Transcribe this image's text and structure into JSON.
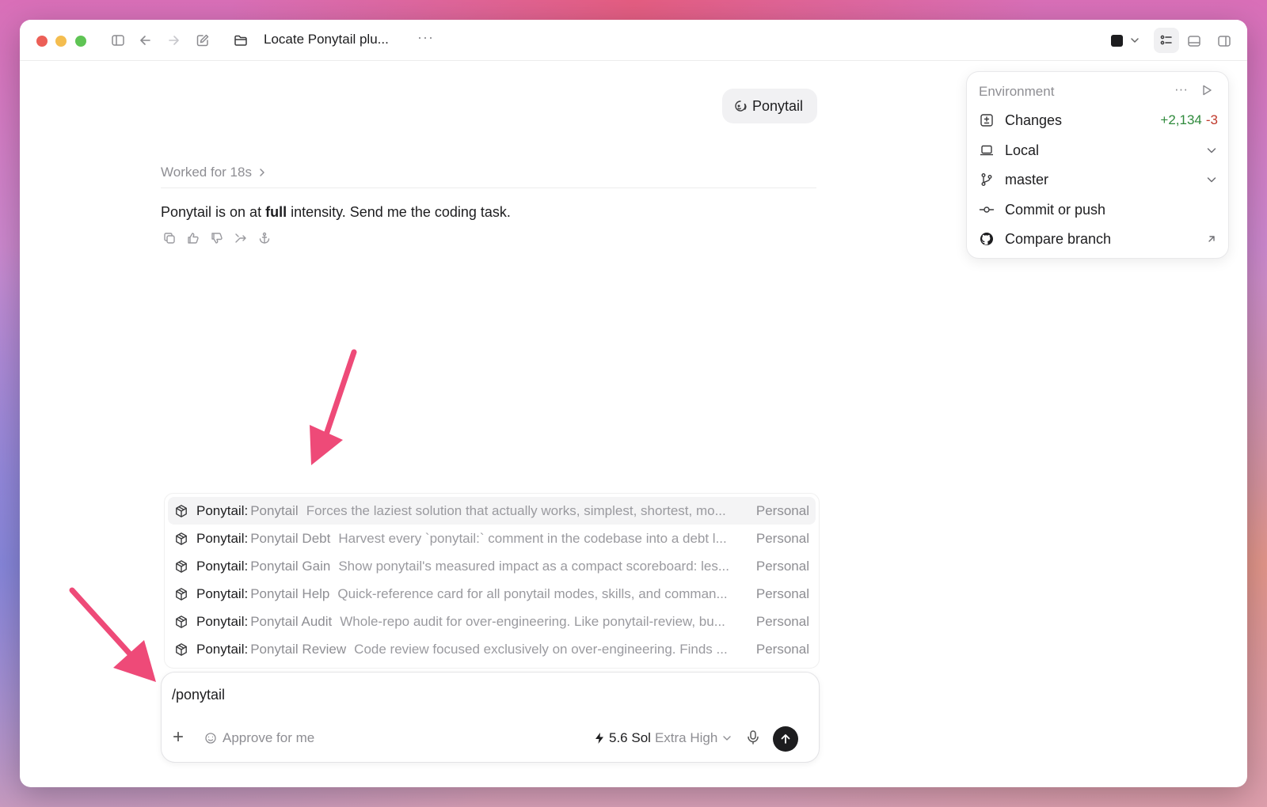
{
  "window": {
    "title": "Locate Ponytail plu...",
    "more_label": "···"
  },
  "chat": {
    "user_message": "Ponytail",
    "worked_label": "Worked for 18s",
    "assistant_message": {
      "before": "Ponytail is on at ",
      "bold": "full",
      "after": " intensity. Send me the coding task."
    }
  },
  "environment": {
    "title": "Environment",
    "more_label": "···",
    "changes": {
      "label": "Changes",
      "added": "+2,134",
      "removed": "-3"
    },
    "location": {
      "label": "Local"
    },
    "branch": {
      "label": "master"
    },
    "commit": {
      "label": "Commit or push"
    },
    "compare": {
      "label": "Compare branch"
    }
  },
  "suggestions": [
    {
      "plugin": "Ponytail",
      "skill": "Ponytail",
      "description": "Forces the laziest solution that actually works, simplest, shortest, mo...",
      "scope": "Personal",
      "selected": true
    },
    {
      "plugin": "Ponytail",
      "skill": "Ponytail Debt",
      "description": "Harvest every `ponytail:` comment in the codebase into a debt l...",
      "scope": "Personal",
      "selected": false
    },
    {
      "plugin": "Ponytail",
      "skill": "Ponytail Gain",
      "description": "Show ponytail's measured impact as a compact scoreboard: les...",
      "scope": "Personal",
      "selected": false
    },
    {
      "plugin": "Ponytail",
      "skill": "Ponytail Help",
      "description": "Quick-reference card for all ponytail modes, skills, and comman...",
      "scope": "Personal",
      "selected": false
    },
    {
      "plugin": "Ponytail",
      "skill": "Ponytail Audit",
      "description": "Whole-repo audit for over-engineering. Like ponytail-review, bu...",
      "scope": "Personal",
      "selected": false
    },
    {
      "plugin": "Ponytail",
      "skill": "Ponytail Review",
      "description": "Code review focused exclusively on over-engineering. Finds ...",
      "scope": "Personal",
      "selected": false
    }
  ],
  "composer": {
    "value": "/ponytail",
    "approve_label": "Approve for me",
    "model_name": "5.6 Sol",
    "model_effort": "Extra High"
  },
  "colors": {
    "accent_arrow": "#ee4a78",
    "added": "#2f8a3c",
    "removed": "#c0392b"
  }
}
